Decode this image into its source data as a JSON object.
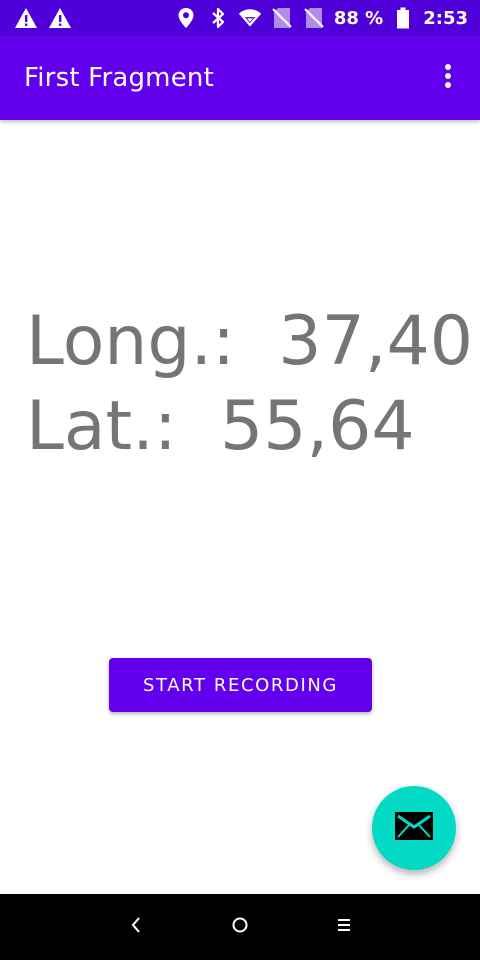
{
  "status_bar": {
    "battery_percent": "88 %",
    "time": "2:53",
    "icons": [
      "warning-icon",
      "warning-icon",
      "location-icon",
      "bluetooth-icon",
      "wifi-icon",
      "no-sim-icon",
      "no-sim-icon",
      "battery-icon"
    ]
  },
  "app_bar": {
    "title": "First Fragment",
    "overflow_icon": "more-vert-icon"
  },
  "main": {
    "longitude_line": "Long.:  37,40",
    "latitude_line": "Lat.:  55,64",
    "record_button_label": "START RECORDING"
  },
  "fab": {
    "icon": "email-icon"
  },
  "nav_bar": {
    "buttons": [
      "back-icon",
      "home-icon",
      "recents-icon"
    ]
  },
  "colors": {
    "status_bar": "#5000d8",
    "primary": "#6200ee",
    "accent": "#03dac5",
    "text_gray": "#757575",
    "nav_bar": "#000000"
  }
}
